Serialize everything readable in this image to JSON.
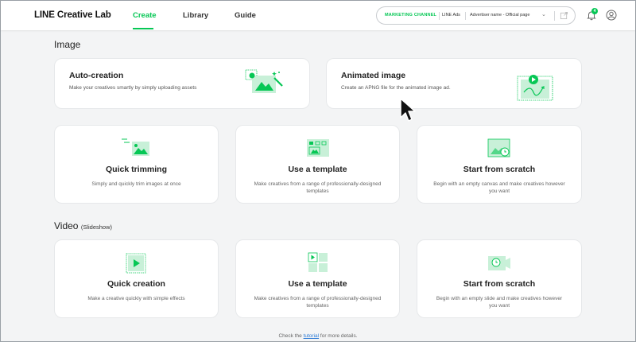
{
  "app": {
    "logo": "LINE Creative Lab"
  },
  "nav": {
    "create": "Create",
    "library": "Library",
    "guide": "Guide"
  },
  "channel": {
    "label": "MARKETING CHANNEL",
    "ads": "LINE Ads",
    "advertiser": "Advertiser name - Official page"
  },
  "notifications": {
    "count": "4"
  },
  "image_section": {
    "title": "Image",
    "auto": {
      "title": "Auto-creation",
      "desc": "Make your creatives smartly by simply uploading assets"
    },
    "animated": {
      "title": "Animated image",
      "desc": "Create an APNG file for the animated image ad."
    },
    "trimming": {
      "title": "Quick trimming",
      "desc": "Simply and quickly trim images at once"
    },
    "template": {
      "title": "Use a template",
      "desc": "Make creatives from a range of professionally-designed templates"
    },
    "scratch": {
      "title": "Start from scratch",
      "desc": "Begin with an empty canvas and make creatives however you want"
    }
  },
  "video_section": {
    "title": "Video",
    "subtitle": "(Slideshow)",
    "quick": {
      "title": "Quick creation",
      "desc": "Make a creative quickly with simple effects"
    },
    "template": {
      "title": "Use a template",
      "desc": "Make creatives from a range of professionally-designed templates"
    },
    "scratch": {
      "title": "Start from scratch",
      "desc": "Begin with an empty slide and make creatives however you want"
    }
  },
  "footer": {
    "prefix": "Check the",
    "link": "tutorial",
    "suffix": "for more details."
  },
  "colors": {
    "accent": "#06c755",
    "illustration": "#c8f0d8"
  }
}
